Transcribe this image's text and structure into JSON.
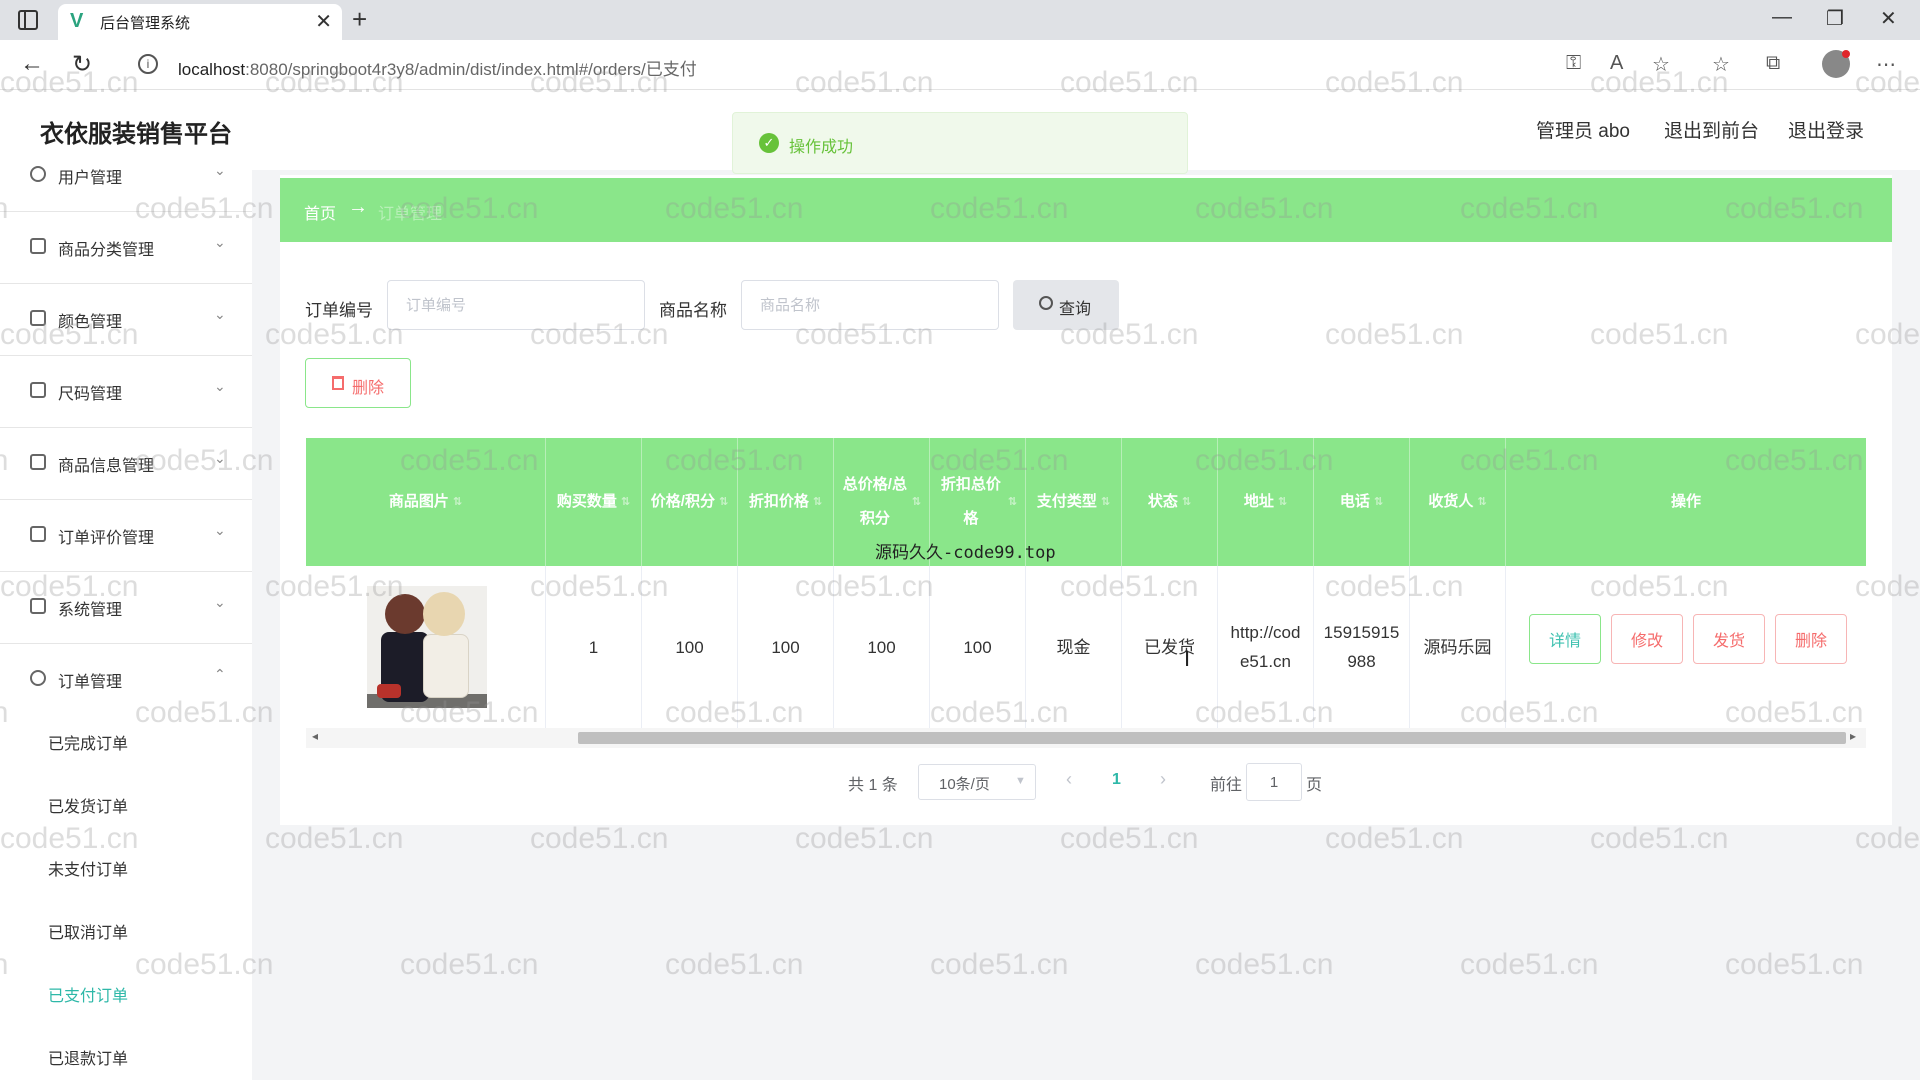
{
  "browser": {
    "tab_title": "后台管理系统",
    "tab_favicon": "V",
    "url_host": "localhost",
    "url_rest": ":8080/springboot4r3y8/admin/dist/index.html#/orders/已支付"
  },
  "app": {
    "title": "衣依服装销售平台",
    "user_label": "管理员 abo",
    "to_front": "退出到前台",
    "logout": "退出登录"
  },
  "toast": {
    "message": "操作成功"
  },
  "sidebar": {
    "items": [
      {
        "label": "用户管理"
      },
      {
        "label": "商品分类管理"
      },
      {
        "label": "颜色管理"
      },
      {
        "label": "尺码管理"
      },
      {
        "label": "商品信息管理"
      },
      {
        "label": "订单评价管理"
      },
      {
        "label": "系统管理"
      },
      {
        "label": "订单管理"
      }
    ],
    "subitems": [
      {
        "label": "已完成订单"
      },
      {
        "label": "已发货订单"
      },
      {
        "label": "未支付订单"
      },
      {
        "label": "已取消订单"
      },
      {
        "label": "已支付订单"
      },
      {
        "label": "已退款订单"
      }
    ]
  },
  "breadcrumb": {
    "home": "首页",
    "arrow": "→",
    "current": "订单管理"
  },
  "search": {
    "order_no_label": "订单编号",
    "order_no_placeholder": "订单编号",
    "product_name_label": "商品名称",
    "product_name_placeholder": "商品名称",
    "query_label": "查询"
  },
  "actions": {
    "delete_label": "删除"
  },
  "table": {
    "headers": [
      "商品图片",
      "购买数量",
      "价格/积分",
      "折扣价格",
      "总价格/总积分",
      "折扣总价格",
      "支付类型",
      "状态",
      "地址",
      "电话",
      "收货人",
      "操作"
    ],
    "row": {
      "quantity": "1",
      "price": "100",
      "discount_price": "100",
      "total": "100",
      "discount_total": "100",
      "pay_type": "现金",
      "status": "已发货",
      "address": "http://code51.cn",
      "phone": "15915915988",
      "receiver": "源码乐园",
      "ops": [
        "详情",
        "修改",
        "发货",
        "删除"
      ]
    }
  },
  "pagination": {
    "total": "共 1 条",
    "page_size": "10条/页",
    "current": "1",
    "goto_label": "前往",
    "goto_value": "1",
    "unit": "页"
  },
  "overlay": {
    "caption": "源码久久-code99.top"
  },
  "watermark": {
    "text": "code51.cn"
  }
}
